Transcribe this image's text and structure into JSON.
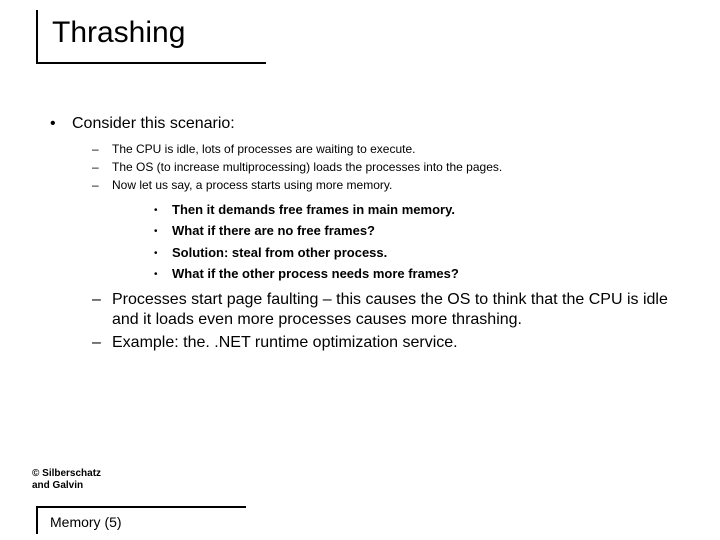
{
  "title": "Thrashing",
  "main": {
    "heading": "Consider this scenario:",
    "sub_small": [
      "The CPU is idle, lots of processes are waiting to execute.",
      "The OS (to increase multiprocessing) loads the processes into the pages.",
      "Now let us say, a process starts using more memory."
    ],
    "nested_bold": [
      "Then it demands free frames in main memory.",
      "What if there are no free frames?",
      "Solution: steal from other process.",
      "What if the other process needs more frames?"
    ],
    "sub_big": [
      "Processes start page faulting – this causes the OS to think that the CPU is idle and it loads even more processes causes more thrashing.",
      "Example: the. .NET runtime optimization service."
    ]
  },
  "copyright_line1": "© Silberschatz",
  "copyright_line2": "and Galvin",
  "footer": "Memory (5)"
}
